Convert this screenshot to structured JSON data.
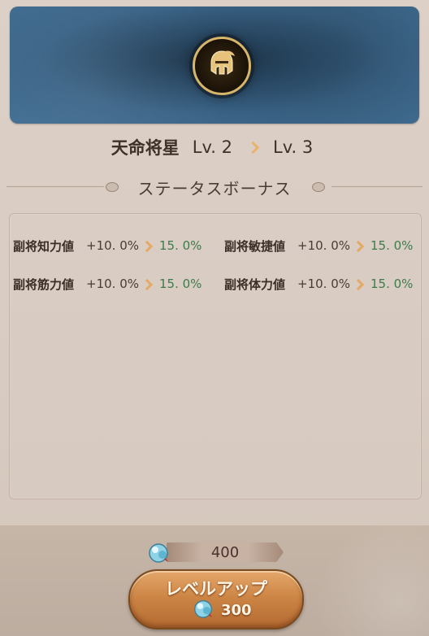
{
  "header": {
    "emblem_icon": "helmet-icon",
    "skill_name": "天命将星",
    "level_from": "Lv. 2",
    "level_to": "Lv. 3"
  },
  "section": {
    "title": "ステータスボーナス"
  },
  "stats": [
    {
      "label": "副将知力値",
      "current": "+10. 0%",
      "next": "15. 0%"
    },
    {
      "label": "副将敏捷値",
      "current": "+10. 0%",
      "next": "15. 0%"
    },
    {
      "label": "副将筋力値",
      "current": "+10. 0%",
      "next": "15. 0%"
    },
    {
      "label": "副将体力値",
      "current": "+10. 0%",
      "next": "15. 0%"
    }
  ],
  "resource": {
    "icon": "crystal-icon",
    "owned": "400"
  },
  "level_up_button": {
    "label": "レベルアップ",
    "cost": "300",
    "cost_icon": "crystal-icon"
  },
  "colors": {
    "banner": "#2d4f6c",
    "increase_value": "#3e7b4a",
    "arrow": "#e5a963",
    "button": "#cd8646"
  }
}
